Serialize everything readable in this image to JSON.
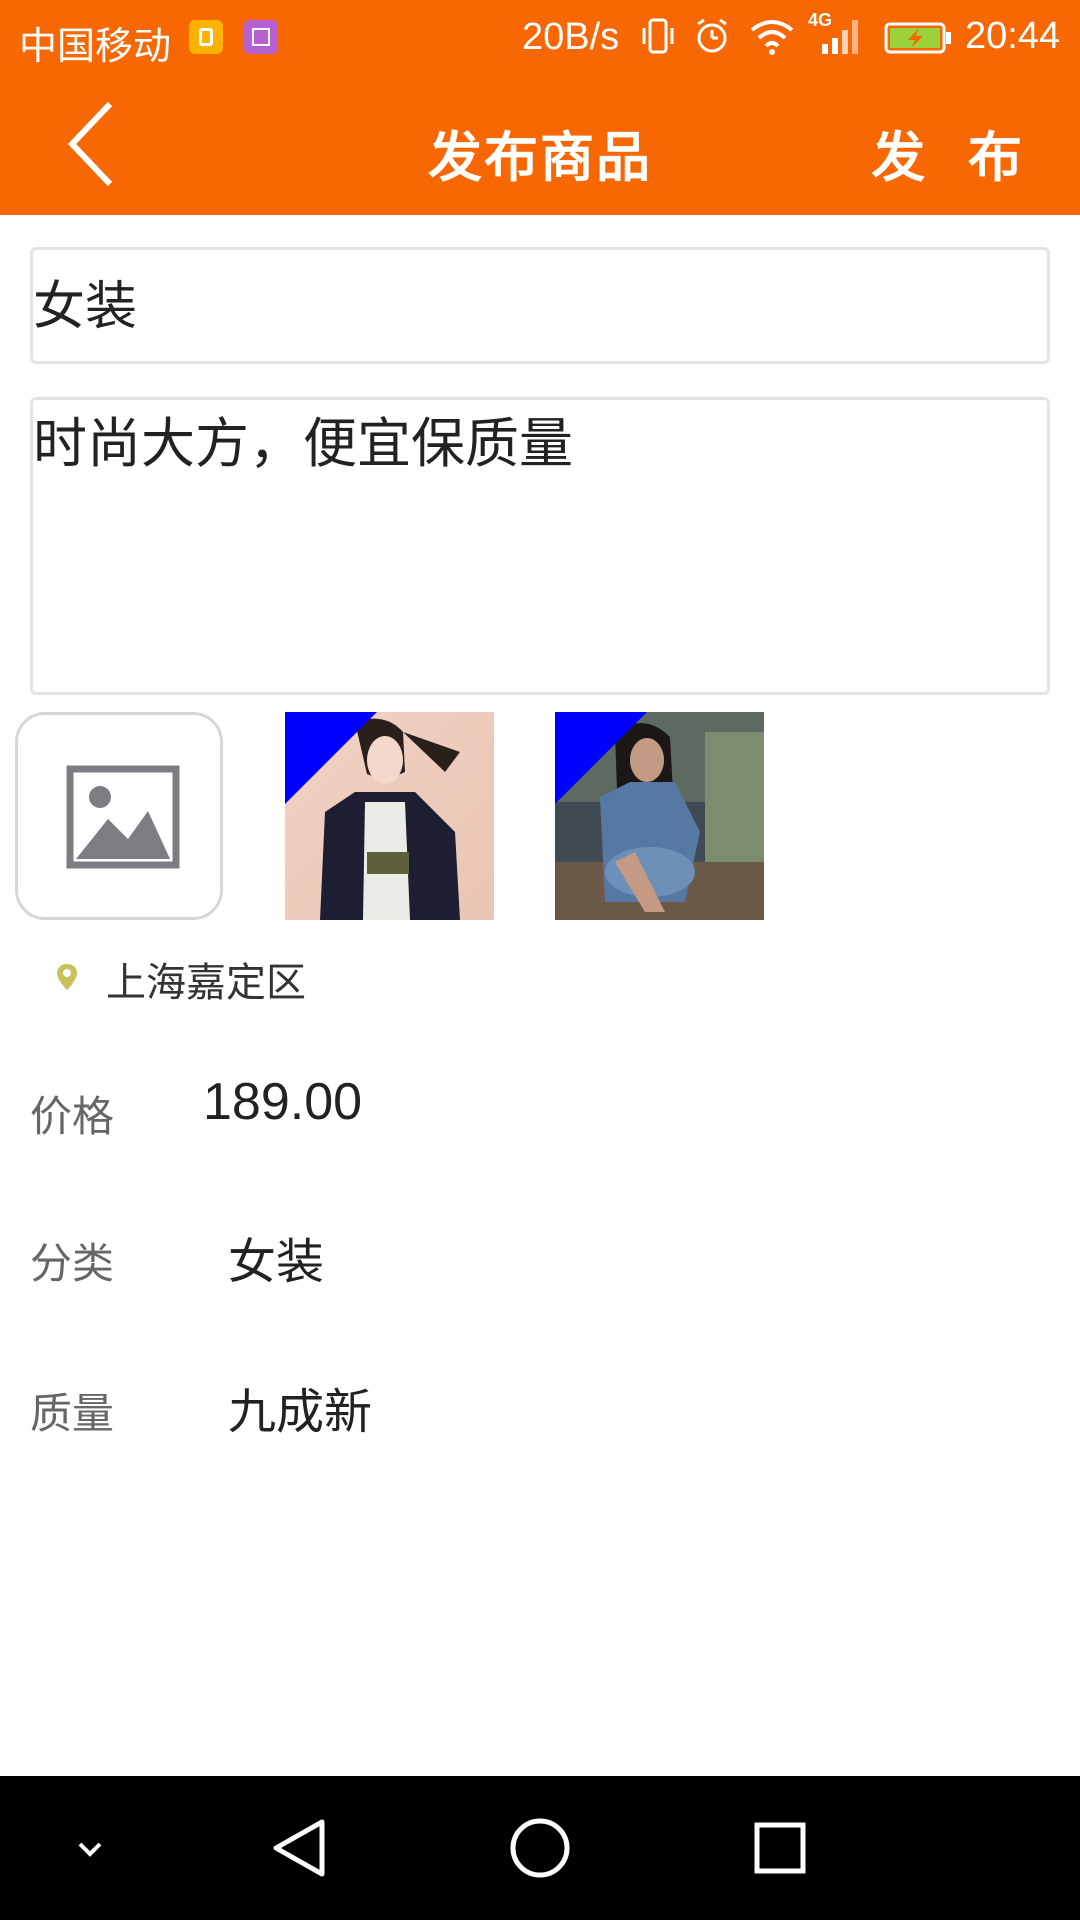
{
  "status_bar": {
    "carrier": "中国移动",
    "net_speed": "20B/s",
    "network_type": "4G",
    "time": "20:44",
    "icons": [
      "sim-app-icon",
      "gallery-app-icon",
      "vibrate-icon",
      "alarm-icon",
      "wifi-icon",
      "signal-icon",
      "battery-charging-icon"
    ]
  },
  "header": {
    "title": "发布商品",
    "publish_label": "发 布",
    "back_icon": "chevron-left-icon"
  },
  "form": {
    "title_value": "女装",
    "description_value": "时尚大方，便宜保质量",
    "add_image_icon": "image-placeholder-icon",
    "location_icon": "map-pin-icon",
    "location": "上海嘉定区",
    "price_label": "价格",
    "price_value": "189.00",
    "category_label": "分类",
    "category_value": "女装",
    "quality_label": "质量",
    "quality_value": "九成新"
  },
  "nav_bar": {
    "icons": [
      "chevron-down-icon",
      "back-triangle-icon",
      "home-circle-icon",
      "recents-square-icon"
    ]
  },
  "colors": {
    "accent": "#F76704",
    "thumb_corner": "#0000FF",
    "pin": "#C8C25A"
  }
}
